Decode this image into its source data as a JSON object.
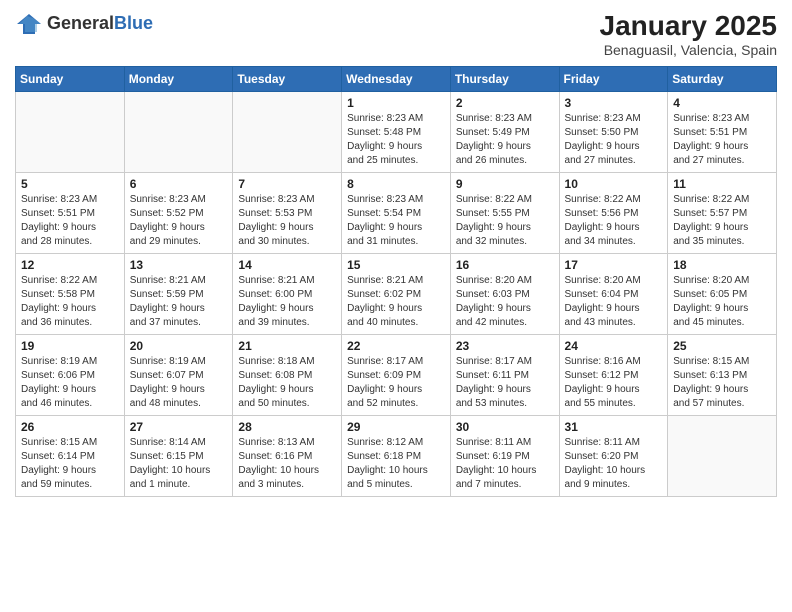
{
  "logo": {
    "general": "General",
    "blue": "Blue"
  },
  "title": {
    "month": "January 2025",
    "location": "Benaguasil, Valencia, Spain"
  },
  "days_of_week": [
    "Sunday",
    "Monday",
    "Tuesday",
    "Wednesday",
    "Thursday",
    "Friday",
    "Saturday"
  ],
  "weeks": [
    [
      {
        "day": "",
        "info": ""
      },
      {
        "day": "",
        "info": ""
      },
      {
        "day": "",
        "info": ""
      },
      {
        "day": "1",
        "info": "Sunrise: 8:23 AM\nSunset: 5:48 PM\nDaylight: 9 hours\nand 25 minutes."
      },
      {
        "day": "2",
        "info": "Sunrise: 8:23 AM\nSunset: 5:49 PM\nDaylight: 9 hours\nand 26 minutes."
      },
      {
        "day": "3",
        "info": "Sunrise: 8:23 AM\nSunset: 5:50 PM\nDaylight: 9 hours\nand 27 minutes."
      },
      {
        "day": "4",
        "info": "Sunrise: 8:23 AM\nSunset: 5:51 PM\nDaylight: 9 hours\nand 27 minutes."
      }
    ],
    [
      {
        "day": "5",
        "info": "Sunrise: 8:23 AM\nSunset: 5:51 PM\nDaylight: 9 hours\nand 28 minutes."
      },
      {
        "day": "6",
        "info": "Sunrise: 8:23 AM\nSunset: 5:52 PM\nDaylight: 9 hours\nand 29 minutes."
      },
      {
        "day": "7",
        "info": "Sunrise: 8:23 AM\nSunset: 5:53 PM\nDaylight: 9 hours\nand 30 minutes."
      },
      {
        "day": "8",
        "info": "Sunrise: 8:23 AM\nSunset: 5:54 PM\nDaylight: 9 hours\nand 31 minutes."
      },
      {
        "day": "9",
        "info": "Sunrise: 8:22 AM\nSunset: 5:55 PM\nDaylight: 9 hours\nand 32 minutes."
      },
      {
        "day": "10",
        "info": "Sunrise: 8:22 AM\nSunset: 5:56 PM\nDaylight: 9 hours\nand 34 minutes."
      },
      {
        "day": "11",
        "info": "Sunrise: 8:22 AM\nSunset: 5:57 PM\nDaylight: 9 hours\nand 35 minutes."
      }
    ],
    [
      {
        "day": "12",
        "info": "Sunrise: 8:22 AM\nSunset: 5:58 PM\nDaylight: 9 hours\nand 36 minutes."
      },
      {
        "day": "13",
        "info": "Sunrise: 8:21 AM\nSunset: 5:59 PM\nDaylight: 9 hours\nand 37 minutes."
      },
      {
        "day": "14",
        "info": "Sunrise: 8:21 AM\nSunset: 6:00 PM\nDaylight: 9 hours\nand 39 minutes."
      },
      {
        "day": "15",
        "info": "Sunrise: 8:21 AM\nSunset: 6:02 PM\nDaylight: 9 hours\nand 40 minutes."
      },
      {
        "day": "16",
        "info": "Sunrise: 8:20 AM\nSunset: 6:03 PM\nDaylight: 9 hours\nand 42 minutes."
      },
      {
        "day": "17",
        "info": "Sunrise: 8:20 AM\nSunset: 6:04 PM\nDaylight: 9 hours\nand 43 minutes."
      },
      {
        "day": "18",
        "info": "Sunrise: 8:20 AM\nSunset: 6:05 PM\nDaylight: 9 hours\nand 45 minutes."
      }
    ],
    [
      {
        "day": "19",
        "info": "Sunrise: 8:19 AM\nSunset: 6:06 PM\nDaylight: 9 hours\nand 46 minutes."
      },
      {
        "day": "20",
        "info": "Sunrise: 8:19 AM\nSunset: 6:07 PM\nDaylight: 9 hours\nand 48 minutes."
      },
      {
        "day": "21",
        "info": "Sunrise: 8:18 AM\nSunset: 6:08 PM\nDaylight: 9 hours\nand 50 minutes."
      },
      {
        "day": "22",
        "info": "Sunrise: 8:17 AM\nSunset: 6:09 PM\nDaylight: 9 hours\nand 52 minutes."
      },
      {
        "day": "23",
        "info": "Sunrise: 8:17 AM\nSunset: 6:11 PM\nDaylight: 9 hours\nand 53 minutes."
      },
      {
        "day": "24",
        "info": "Sunrise: 8:16 AM\nSunset: 6:12 PM\nDaylight: 9 hours\nand 55 minutes."
      },
      {
        "day": "25",
        "info": "Sunrise: 8:15 AM\nSunset: 6:13 PM\nDaylight: 9 hours\nand 57 minutes."
      }
    ],
    [
      {
        "day": "26",
        "info": "Sunrise: 8:15 AM\nSunset: 6:14 PM\nDaylight: 9 hours\nand 59 minutes."
      },
      {
        "day": "27",
        "info": "Sunrise: 8:14 AM\nSunset: 6:15 PM\nDaylight: 10 hours\nand 1 minute."
      },
      {
        "day": "28",
        "info": "Sunrise: 8:13 AM\nSunset: 6:16 PM\nDaylight: 10 hours\nand 3 minutes."
      },
      {
        "day": "29",
        "info": "Sunrise: 8:12 AM\nSunset: 6:18 PM\nDaylight: 10 hours\nand 5 minutes."
      },
      {
        "day": "30",
        "info": "Sunrise: 8:11 AM\nSunset: 6:19 PM\nDaylight: 10 hours\nand 7 minutes."
      },
      {
        "day": "31",
        "info": "Sunrise: 8:11 AM\nSunset: 6:20 PM\nDaylight: 10 hours\nand 9 minutes."
      },
      {
        "day": "",
        "info": ""
      }
    ]
  ]
}
